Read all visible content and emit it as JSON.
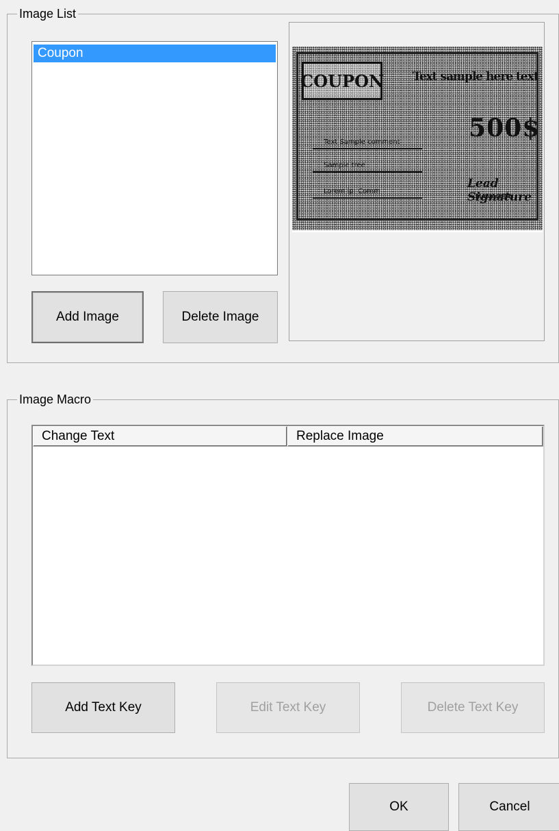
{
  "image_list": {
    "group_title": "Image List",
    "items": [
      {
        "label": "Coupon",
        "selected": true
      }
    ],
    "add_button": "Add Image",
    "delete_button": "Delete Image"
  },
  "preview": {
    "title_box": "COUPON",
    "sample_text": "Text sample here text",
    "amount": "500$",
    "line_labels": [
      "Text Sample comment",
      "Sample tree",
      "Lorem ip: Comm"
    ],
    "signature": "Lead Signature",
    "signature_sub": "MANAGER"
  },
  "image_macro": {
    "group_title": "Image Macro",
    "columns": [
      "Change Text",
      "Replace Image"
    ],
    "rows": [],
    "add_button": "Add Text Key",
    "edit_button": "Edit Text Key",
    "delete_button": "Delete Text Key"
  },
  "footer": {
    "ok_button": "OK",
    "cancel_button": "Cancel"
  },
  "colors": {
    "background": "#f0f0f0",
    "selection": "#3399ff",
    "disabled_text": "#a0a0a0"
  }
}
